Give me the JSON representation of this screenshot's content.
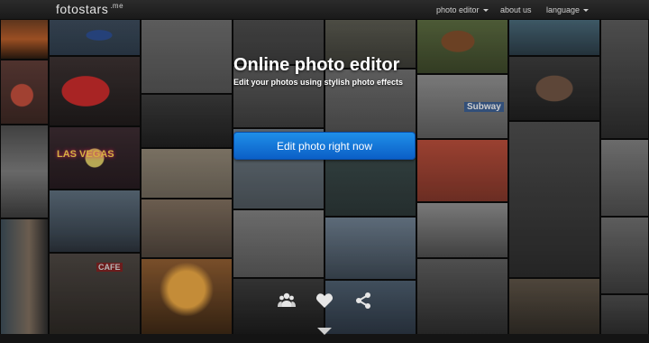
{
  "navbar": {
    "brand": "fotostars",
    "brand_suffix": ".me",
    "menu": [
      {
        "label": "photo editor",
        "has_dropdown": true
      },
      {
        "label": "about us",
        "has_dropdown": false
      },
      {
        "label": "language",
        "has_dropdown": true
      }
    ]
  },
  "hero": {
    "title": "Online photo editor",
    "subtitle": "Edit your photos using stylish photo effects",
    "cta_label": "Edit photo right now"
  },
  "tile_text": {
    "las_vegas": "LAS VEGAS",
    "cafe": "CAFE",
    "subway": "Subway"
  },
  "colors": {
    "navbar_bg": "#222222",
    "cta_top": "#1f8fe8",
    "cta_bottom": "#0b5fc7"
  },
  "icons": [
    "group-icon",
    "heart-icon",
    "share-icon",
    "down-arrow-icon"
  ]
}
